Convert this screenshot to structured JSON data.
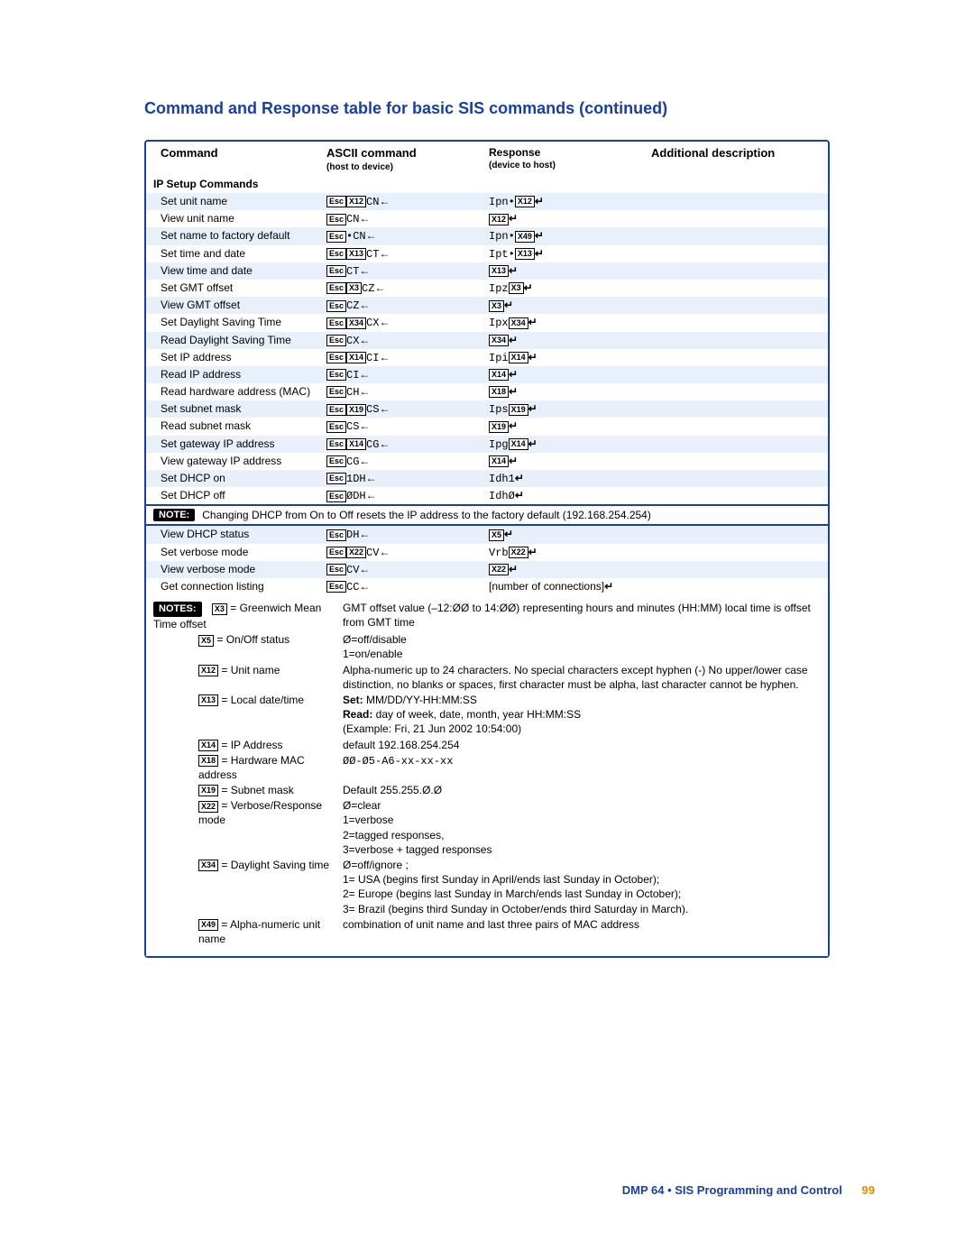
{
  "page_title": "Command and Response table for basic SIS commands (continued)",
  "headers": {
    "c1": "Command",
    "c2": "ASCII command",
    "c2sub": "(host to device)",
    "c3": "Response",
    "c3sub": "(device to host)",
    "c4": "Additional description"
  },
  "section": "IP Setup Commands",
  "rows": [
    {
      "cmd": "Set unit name",
      "a_pre": "Esc",
      "a_x": "X12",
      "a_suf": "CN",
      "r_pre": "Ipn•",
      "r_x": "X12"
    },
    {
      "cmd": "View unit name",
      "a_pre": "Esc",
      "a_suf": "CN",
      "r_x": "X12"
    },
    {
      "cmd": "Set name to factory default",
      "a_pre": "Esc",
      "a_mid": "•",
      "a_suf": "CN",
      "r_pre": "Ipn•",
      "r_x": "X49"
    },
    {
      "cmd": "Set time and date",
      "a_pre": "Esc",
      "a_x": "X13",
      "a_suf": "CT",
      "r_pre": "Ipt•",
      "r_x": "X13"
    },
    {
      "cmd": "View time and date",
      "a_pre": "Esc",
      "a_suf": "CT",
      "r_x": "X13"
    },
    {
      "cmd": "Set GMT offset",
      "a_pre": "Esc",
      "a_x": "X3",
      "a_suf": "CZ",
      "r_pre": "Ipz",
      "r_x": "X3"
    },
    {
      "cmd": "View GMT offset",
      "a_pre": "Esc",
      "a_suf": "CZ",
      "r_x": "X3"
    },
    {
      "cmd": "Set Daylight Saving Time",
      "a_pre": "Esc",
      "a_x": "X34",
      "a_suf": "CX",
      "r_pre": "Ipx",
      "r_x": "X34"
    },
    {
      "cmd": "Read Daylight Saving Time",
      "a_pre": "Esc",
      "a_suf": "CX",
      "r_x": "X34"
    },
    {
      "cmd": "Set IP address",
      "a_pre": "Esc",
      "a_x": "X14",
      "a_suf": "CI",
      "r_pre": "Ipi",
      "r_x": "X14"
    },
    {
      "cmd": "Read IP address",
      "a_pre": "Esc",
      "a_suf": "CI",
      "r_x": "X14"
    },
    {
      "cmd": "Read hardware address (MAC)",
      "a_pre": "Esc",
      "a_suf": "CH",
      "r_x": "X18"
    },
    {
      "cmd": "Set subnet mask",
      "a_pre": "Esc",
      "a_x": "X19",
      "a_suf": "CS",
      "r_pre": "Ips",
      "r_x": "X19"
    },
    {
      "cmd": "Read subnet mask",
      "a_pre": "Esc",
      "a_suf": "CS",
      "r_x": "X19"
    },
    {
      "cmd": "Set gateway IP address",
      "a_pre": "Esc",
      "a_x": "X14",
      "a_suf": "CG",
      "r_pre": "Ipg",
      "r_x": "X14"
    },
    {
      "cmd": "View gateway IP address",
      "a_pre": "Esc",
      "a_suf": "CG",
      "r_x": "X14"
    },
    {
      "cmd": "Set DHCP on",
      "a_pre": "Esc",
      "a_lit": "1DH",
      "r_lit": "Idh1"
    },
    {
      "cmd": "Set DHCP off",
      "a_pre": "Esc",
      "a_lit": "ØDH",
      "r_lit": "IdhØ"
    }
  ],
  "note_label": "NOTE:",
  "note_text": "Changing DHCP from On to Off resets the IP address to the factory default (192.168.254.254)",
  "rows2": [
    {
      "cmd": "View DHCP status",
      "a_pre": "Esc",
      "a_suf": "DH",
      "r_x": "X5"
    },
    {
      "cmd": "Set verbose mode",
      "a_pre": "Esc",
      "a_x": "X22",
      "a_suf": "CV",
      "r_pre": "Vrb",
      "r_x": "X22"
    },
    {
      "cmd": "View verbose mode",
      "a_pre": "Esc",
      "a_suf": "CV",
      "r_x": "X22"
    },
    {
      "cmd": "Get connection listing",
      "a_pre": "Esc",
      "a_suf": "CC",
      "r_text": "[number of connections]"
    }
  ],
  "notes_label": "NOTES:",
  "notes": [
    {
      "x": "X3",
      "k": " = Greenwich Mean Time offset",
      "v": "GMT offset value (–12:ØØ to 14:ØØ) representing hours and minutes (HH:MM) local time is offset from GMT time"
    },
    {
      "x": "X5",
      "k": " = On/Off status",
      "v": "Ø=off/disable\n1=on/enable"
    },
    {
      "x": "X12",
      "k": " = Unit name",
      "v": "Alpha-numeric up to 24 characters. No special characters except hyphen (-) No upper/lower case distinction, no blanks or spaces, first character must be alpha, last character cannot be hyphen."
    },
    {
      "x": "X13",
      "k": " = Local date/time",
      "v_html": "set_read"
    },
    {
      "x": "X14",
      "k": " = IP Address",
      "v": "default 192.168.254.254"
    },
    {
      "x": "X18",
      "k": " = Hardware MAC address",
      "v": "ØØ-Ø5-A6-xx-xx-xx",
      "mono": true
    },
    {
      "x": "X19",
      "k": " = Subnet mask",
      "v": "Default 255.255.Ø.Ø"
    },
    {
      "x": "X22",
      "k": " = Verbose/Response mode",
      "v": "Ø=clear\n1=verbose\n2=tagged responses,\n3=verbose + tagged responses"
    },
    {
      "x": "X34",
      "k": " = Daylight Saving time",
      "v": "Ø=off/ignore ;\n1= USA (begins first Sunday in April/ends last Sunday in October);\n2= Europe (begins last Sunday in March/ends last Sunday in October);\n3= Brazil (begins third Sunday in October/ends third Saturday in March)."
    },
    {
      "x": "X49",
      "k": " = Alpha-numeric unit name",
      "v": "combination of unit name and last three pairs of MAC address"
    }
  ],
  "notes_x13": {
    "set_label": "Set:",
    "set_val": " MM/DD/YY-HH:MM:SS",
    "read_label": "Read:",
    "read_val": " day of week, date, month, year HH:MM:SS",
    "example": "(Example: Fri, 21 Jun 2002 10:54:00)"
  },
  "footer": {
    "left": "DMP 64 • SIS Programming and Control",
    "page": "99"
  }
}
